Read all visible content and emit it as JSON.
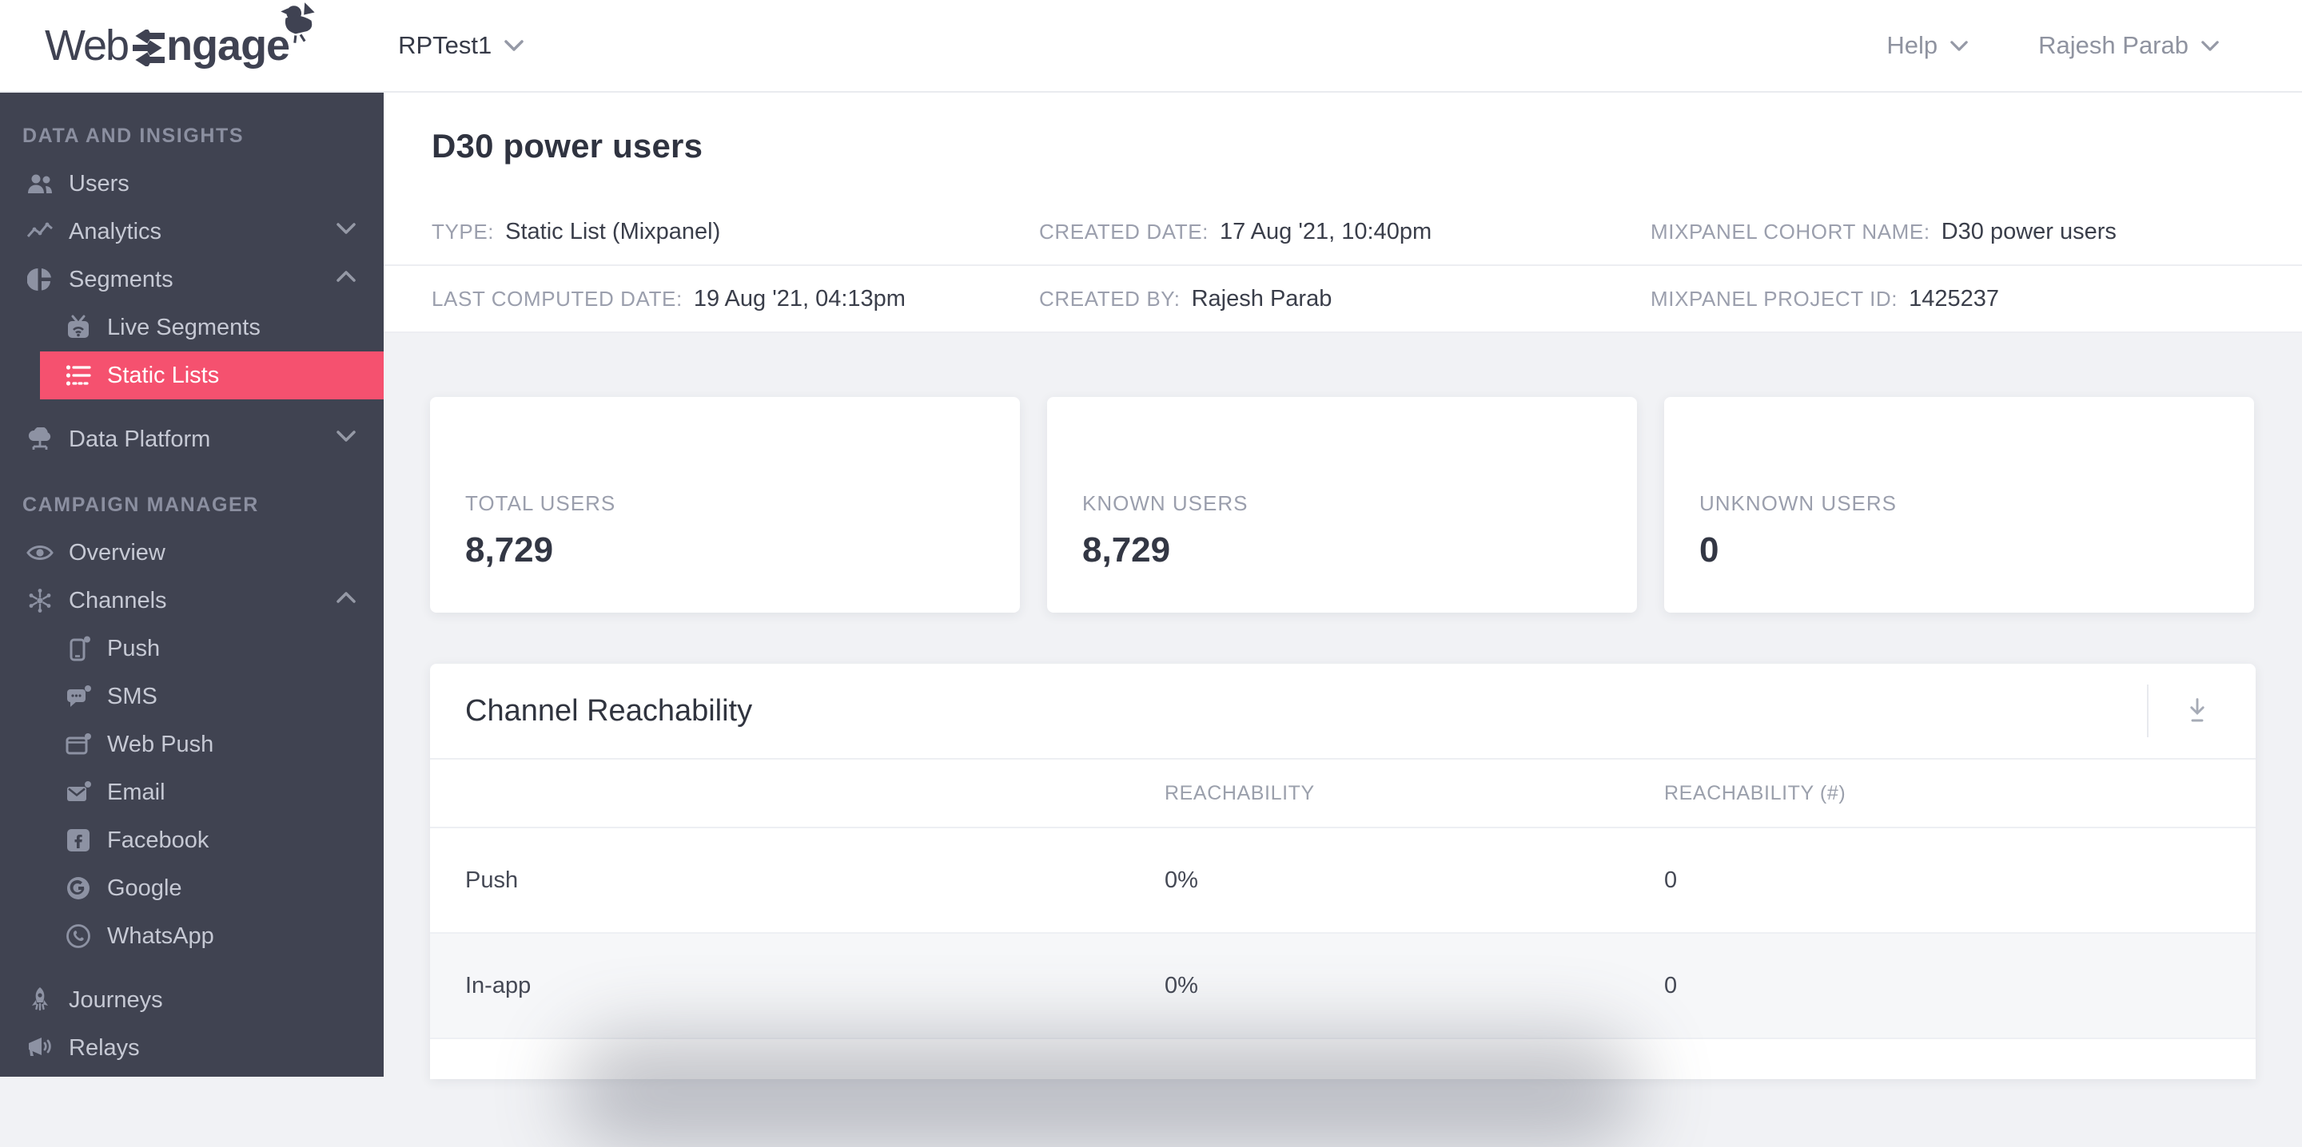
{
  "topbar": {
    "logo_web": "Web",
    "logo_ngage": "ngage",
    "project": "RPTest1",
    "help_label": "Help",
    "user_name": "Rajesh Parab"
  },
  "sidebar": {
    "sections": [
      {
        "label": "DATA AND INSIGHTS",
        "items": [
          {
            "label": "Users",
            "icon": "users-icon"
          },
          {
            "label": "Analytics",
            "icon": "analytics-icon",
            "chevron": "down"
          },
          {
            "label": "Segments",
            "icon": "segments-icon",
            "chevron": "up",
            "children": [
              {
                "label": "Live Segments",
                "icon": "live-segments-icon"
              },
              {
                "label": "Static Lists",
                "icon": "static-lists-icon",
                "active": true
              }
            ]
          },
          {
            "label": "Data Platform",
            "icon": "data-platform-icon",
            "chevron": "down"
          }
        ]
      },
      {
        "label": "CAMPAIGN MANAGER",
        "items": [
          {
            "label": "Overview",
            "icon": "overview-icon"
          },
          {
            "label": "Channels",
            "icon": "channels-icon",
            "chevron": "up",
            "children": [
              {
                "label": "Push",
                "icon": "push-icon"
              },
              {
                "label": "SMS",
                "icon": "sms-icon"
              },
              {
                "label": "Web Push",
                "icon": "web-push-icon"
              },
              {
                "label": "Email",
                "icon": "email-icon"
              },
              {
                "label": "Facebook",
                "icon": "facebook-icon"
              },
              {
                "label": "Google",
                "icon": "google-icon"
              },
              {
                "label": "WhatsApp",
                "icon": "whatsapp-icon"
              }
            ]
          },
          {
            "label": "Journeys",
            "icon": "journeys-icon"
          },
          {
            "label": "Relays",
            "icon": "relays-icon"
          }
        ]
      }
    ]
  },
  "page": {
    "title": "D30 power users",
    "meta": [
      {
        "label": "TYPE:",
        "value": "Static List (Mixpanel)"
      },
      {
        "label": "CREATED DATE:",
        "value": "17 Aug '21, 10:40pm"
      },
      {
        "label": "MIXPANEL COHORT NAME:",
        "value": "D30 power users"
      },
      {
        "label": "LAST COMPUTED DATE:",
        "value": "19 Aug '21, 04:13pm"
      },
      {
        "label": "CREATED BY:",
        "value": "Rajesh Parab"
      },
      {
        "label": "MIXPANEL PROJECT ID:",
        "value": "1425237"
      }
    ],
    "stats": [
      {
        "label": "TOTAL USERS",
        "value": "8,729"
      },
      {
        "label": "KNOWN USERS",
        "value": "8,729"
      },
      {
        "label": "UNKNOWN USERS",
        "value": "0"
      }
    ],
    "reachability": {
      "title": "Channel Reachability",
      "columns": [
        "REACHABILITY",
        "REACHABILITY (#)"
      ],
      "rows": [
        {
          "channel": "Push",
          "reachability": "0%",
          "count": "0"
        },
        {
          "channel": "In-app",
          "reachability": "0%",
          "count": "0"
        }
      ]
    }
  },
  "colors": {
    "accent_pink": "#f5516f",
    "sidebar_bg": "#404351",
    "page_bg": "#f1f2f5",
    "logo_ink": "#3f4252"
  }
}
